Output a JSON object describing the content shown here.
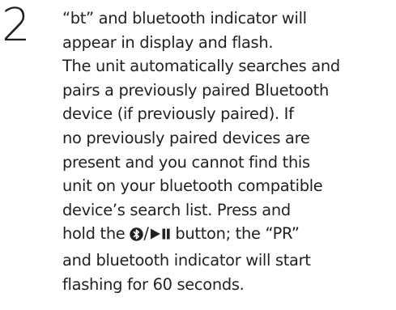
{
  "step": {
    "number": "2"
  },
  "instruction": {
    "lines": [
      "“bt” and bluetooth indicator will",
      "appear in display and flash.",
      "The unit automatically searches and",
      "pairs a previously paired Bluetooth",
      "device (if previously paired). If",
      "no previously paired devices are",
      "present and you cannot find this",
      "unit on your bluetooth compatible",
      "device’s search list. Press and"
    ],
    "press_line_prefix": "hold the ",
    "press_line_separator": "/",
    "press_line_suffix": " button; the “PR”",
    "closing_lines": [
      "and bluetooth indicator will start",
      "flashing for 60 seconds."
    ]
  },
  "icons": {
    "bluetooth": "bluetooth-icon",
    "play_pause": "play-pause-icon"
  },
  "colors": {
    "text": "#231f20",
    "background": "#ffffff"
  }
}
